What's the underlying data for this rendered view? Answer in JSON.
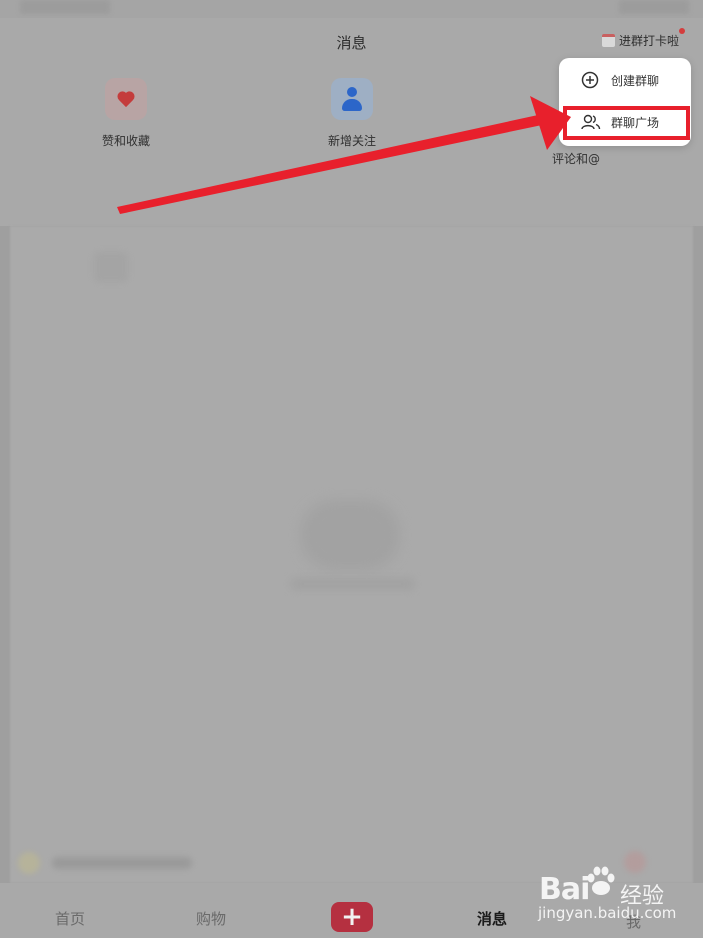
{
  "header": {
    "title": "消息",
    "checkin_label": "进群打卡啦"
  },
  "quick_actions": {
    "likes_label": "赞和收藏",
    "follow_label": "新增关注",
    "comments_label": "评论和@"
  },
  "popup_menu": {
    "create_group_label": "创建群聊",
    "group_plaza_label": "群聊广场"
  },
  "tab_bar": {
    "home": "首页",
    "shopping": "购物",
    "post": "+",
    "messages": "消息",
    "me": "我"
  },
  "watermark": {
    "brand": "Bai",
    "brand2": "经验",
    "url": "jingyan.baidu.com"
  },
  "colors": {
    "annotation_red": "#e8202c",
    "accent_red": "#b53040",
    "follow_blue": "#2c66c9"
  }
}
